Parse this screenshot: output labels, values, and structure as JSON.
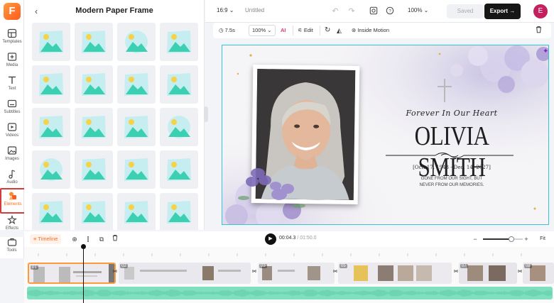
{
  "rail": {
    "logo": "F",
    "items": [
      {
        "label": "Templates",
        "icon": "templates-icon"
      },
      {
        "label": "Media",
        "icon": "media-icon"
      },
      {
        "label": "Text",
        "icon": "text-icon"
      },
      {
        "label": "Subtitles",
        "icon": "subtitles-icon"
      },
      {
        "label": "Videos",
        "icon": "videos-icon"
      },
      {
        "label": "Images",
        "icon": "images-icon"
      },
      {
        "label": "Audio",
        "icon": "audio-icon"
      },
      {
        "label": "Elements",
        "icon": "elements-icon",
        "active": true
      },
      {
        "label": "Effects",
        "icon": "effects-icon"
      },
      {
        "label": "Tools",
        "icon": "tools-icon"
      }
    ]
  },
  "panel": {
    "title": "Modern Paper Frame",
    "back_icon": "chevron-left-icon",
    "tile_count": 20
  },
  "topbar": {
    "ratio": "16:9 ⌄",
    "project_name": "Untitled",
    "zoom": "100% ⌄",
    "saved_label": "Saved",
    "export_label": "Export →",
    "avatar_letter": "E"
  },
  "toolbar": {
    "duration": "7.5s",
    "scale": "100% ⌄",
    "ai_label": "AI",
    "edit_label": "Edit",
    "motion_label": "Inside Motion"
  },
  "canvas": {
    "script_line": "Forever In Our Heart",
    "name": "OLIVIA SMITH",
    "dates": "[Oct. 17, 1943 - Dec. 14, 2027]",
    "memo_line1": "GONE FROM OUR SIGHT, BUT",
    "memo_line2": "NEVER FROM OUR MEMORIES."
  },
  "timeline": {
    "label": "Timeline",
    "current_time": "00:04.3",
    "total_time": "/ 01:50.0",
    "zoom_level": 0.72,
    "fit_label": "Fit",
    "clips": [
      "01",
      "02",
      "03",
      "04",
      "05",
      "06",
      "07",
      "08"
    ]
  },
  "colors": {
    "accent": "#ff6b1a",
    "canvas_border": "#35c4d6",
    "audio_wave": "#7fe0bf",
    "export_bg": "#161616",
    "avatar_bg": "#c2205f"
  }
}
